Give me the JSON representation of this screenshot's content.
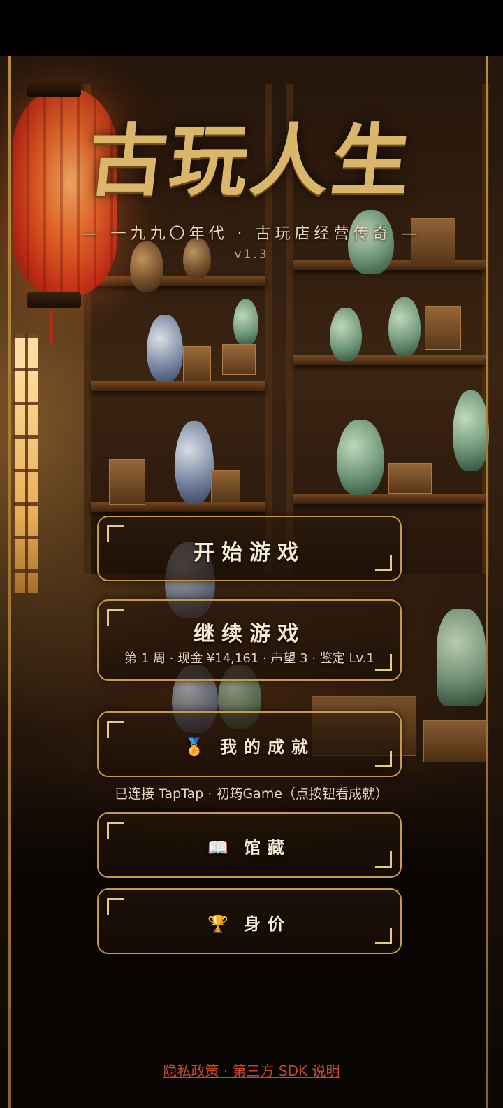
{
  "title": "古玩人生",
  "subtitle": "— 一九九〇年代 · 古玩店经营传奇 —",
  "version": "v1.3",
  "buttons": {
    "start": {
      "label": "开始游戏"
    },
    "continue": {
      "label": "继续游戏",
      "save_info": "第 1 周 · 现金 ¥14,161 · 声望 3 · 鉴定 Lv.1"
    },
    "achievements": {
      "icon": "medal-icon",
      "label": "我的成就"
    },
    "collection": {
      "icon": "book-icon",
      "label": "馆藏"
    },
    "worth": {
      "icon": "trophy-icon",
      "label": "身价"
    }
  },
  "taptap_status": "已连接 TapTap · 初筠Game（点按钮看成就）",
  "privacy_link": "隐私政策 · 第三方 SDK 说明",
  "colors": {
    "gold": "#c79a4a",
    "link": "#c44a2c",
    "background": "#2a1a0e"
  }
}
